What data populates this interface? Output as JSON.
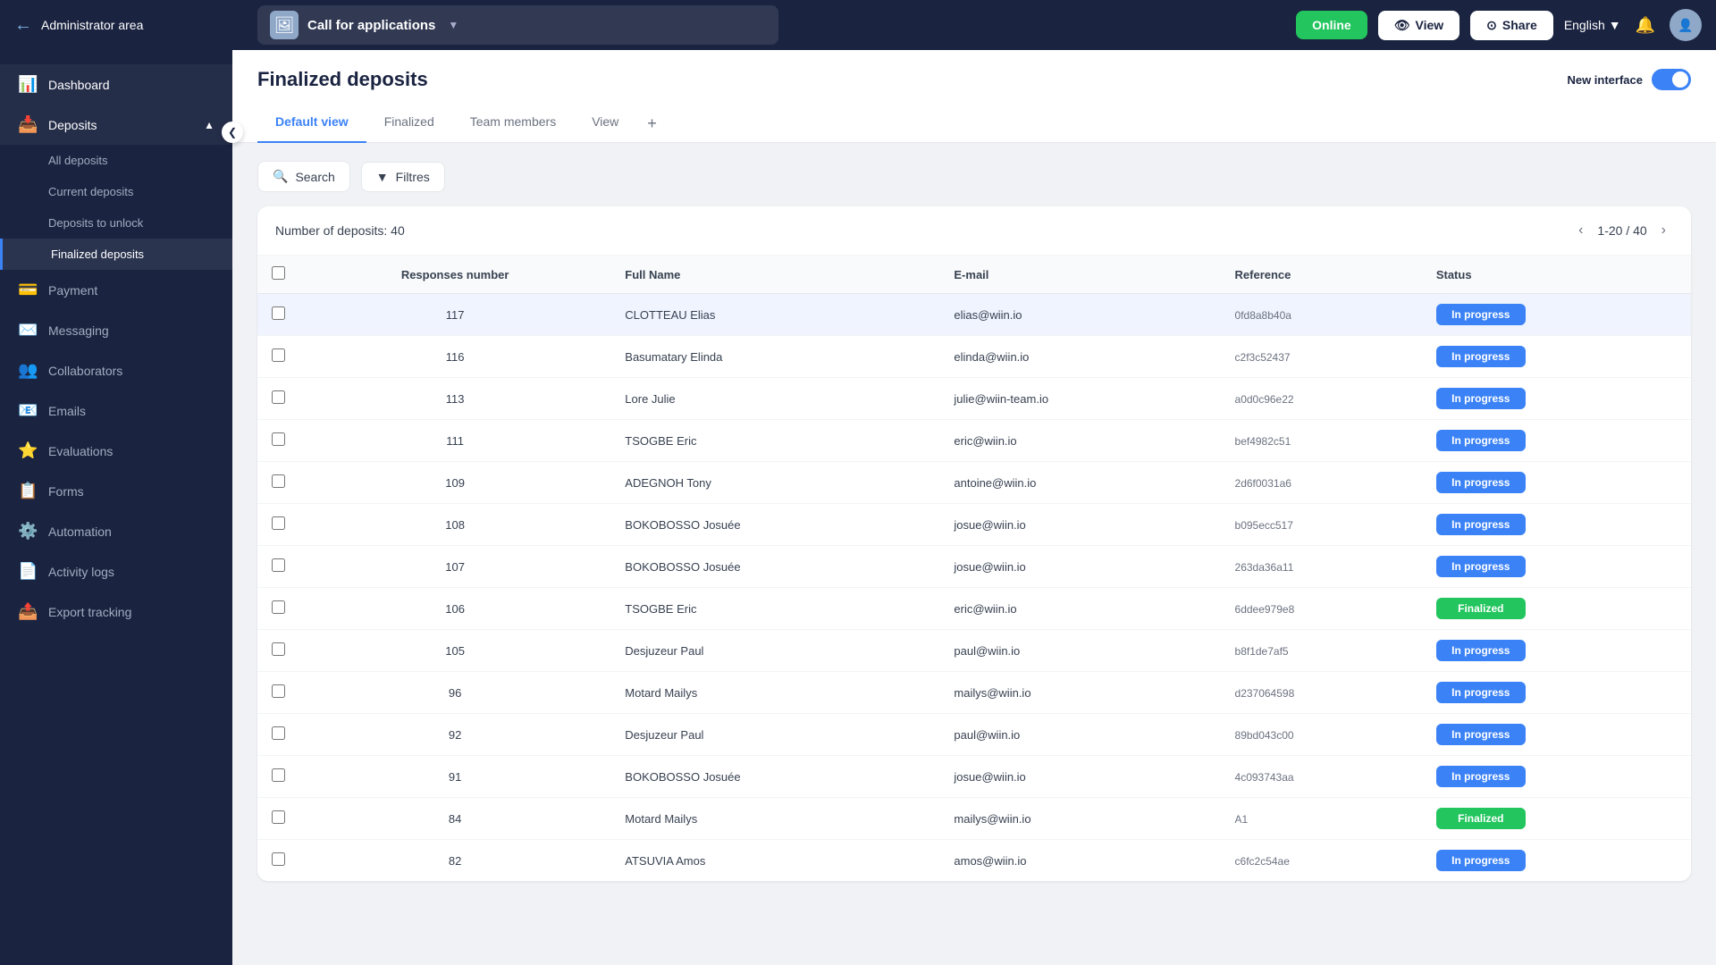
{
  "topNav": {
    "adminLabel": "Administrator area",
    "appName": "Call for applications",
    "btnOnline": "Online",
    "btnView": "View",
    "btnShare": "Share",
    "language": "English",
    "newInterface": "New interface"
  },
  "sidebar": {
    "items": [
      {
        "id": "dashboard",
        "label": "Dashboard",
        "icon": "📊"
      },
      {
        "id": "deposits",
        "label": "Deposits",
        "icon": "📥",
        "expanded": true
      },
      {
        "id": "all-deposits",
        "label": "All deposits",
        "sub": true
      },
      {
        "id": "current-deposits",
        "label": "Current deposits",
        "sub": true
      },
      {
        "id": "deposits-to-unlock",
        "label": "Deposits to unlock",
        "sub": true
      },
      {
        "id": "finalized-deposits",
        "label": "Finalized deposits",
        "sub": true,
        "active": true
      },
      {
        "id": "payment",
        "label": "Payment",
        "icon": "💳"
      },
      {
        "id": "messaging",
        "label": "Messaging",
        "icon": "✉️"
      },
      {
        "id": "collaborators",
        "label": "Collaborators",
        "icon": "👥"
      },
      {
        "id": "emails",
        "label": "Emails",
        "icon": "📧"
      },
      {
        "id": "evaluations",
        "label": "Evaluations",
        "icon": "⭐"
      },
      {
        "id": "forms",
        "label": "Forms",
        "icon": "📋"
      },
      {
        "id": "automation",
        "label": "Automation",
        "icon": "⚙️"
      },
      {
        "id": "activity-logs",
        "label": "Activity logs",
        "icon": "📄"
      },
      {
        "id": "export-tracking",
        "label": "Export tracking",
        "icon": "📤"
      }
    ]
  },
  "page": {
    "title": "Finalized deposits",
    "tabs": [
      {
        "id": "default-view",
        "label": "Default view",
        "active": true
      },
      {
        "id": "finalized",
        "label": "Finalized"
      },
      {
        "id": "team-members",
        "label": "Team members"
      },
      {
        "id": "view",
        "label": "View"
      }
    ],
    "search": "Search",
    "filters": "Filtres",
    "depositCount": "Number of deposits: 40",
    "pagination": "1-20 / 40"
  },
  "table": {
    "columns": [
      "Responses number",
      "Full Name",
      "E-mail",
      "Reference",
      "Status"
    ],
    "rows": [
      {
        "num": "117",
        "name": "CLOTTEAU Elias",
        "email": "elias@wiin.io",
        "ref": "0fd8a8b40a",
        "status": "In progress",
        "hovered": true
      },
      {
        "num": "116",
        "name": "Basumatary Elinda",
        "email": "elinda@wiin.io",
        "ref": "c2f3c52437",
        "status": "In progress"
      },
      {
        "num": "113",
        "name": "Lore Julie",
        "email": "julie@wiin-team.io",
        "ref": "a0d0c96e22",
        "status": "In progress"
      },
      {
        "num": "111",
        "name": "TSOGBE Eric",
        "email": "eric@wiin.io",
        "ref": "bef4982c51",
        "status": "In progress"
      },
      {
        "num": "109",
        "name": "ADEGNOH Tony",
        "email": "antoine@wiin.io",
        "ref": "2d6f0031a6",
        "status": "In progress"
      },
      {
        "num": "108",
        "name": "BOKOBOSSO Josuée",
        "email": "josue@wiin.io",
        "ref": "b095ecc517",
        "status": "In progress"
      },
      {
        "num": "107",
        "name": "BOKOBOSSO Josuée",
        "email": "josue@wiin.io",
        "ref": "263da36a11",
        "status": "In progress"
      },
      {
        "num": "106",
        "name": "TSOGBE Eric",
        "email": "eric@wiin.io",
        "ref": "6ddee979e8",
        "status": "Finalized"
      },
      {
        "num": "105",
        "name": "Desjuzeur Paul",
        "email": "paul@wiin.io",
        "ref": "b8f1de7af5",
        "status": "In progress"
      },
      {
        "num": "96",
        "name": "Motard Mailys",
        "email": "mailys@wiin.io",
        "ref": "d237064598",
        "status": "In progress"
      },
      {
        "num": "92",
        "name": "Desjuzeur Paul",
        "email": "paul@wiin.io",
        "ref": "89bd043c00",
        "status": "In progress"
      },
      {
        "num": "91",
        "name": "BOKOBOSSO Josuée",
        "email": "josue@wiin.io",
        "ref": "4c093743aa",
        "status": "In progress"
      },
      {
        "num": "84",
        "name": "Motard Mailys",
        "email": "mailys@wiin.io",
        "ref": "A1",
        "status": "Finalized"
      },
      {
        "num": "82",
        "name": "ATSUVIA Amos",
        "email": "amos@wiin.io",
        "ref": "c6fc2c54ae",
        "status": "In progress"
      }
    ]
  }
}
